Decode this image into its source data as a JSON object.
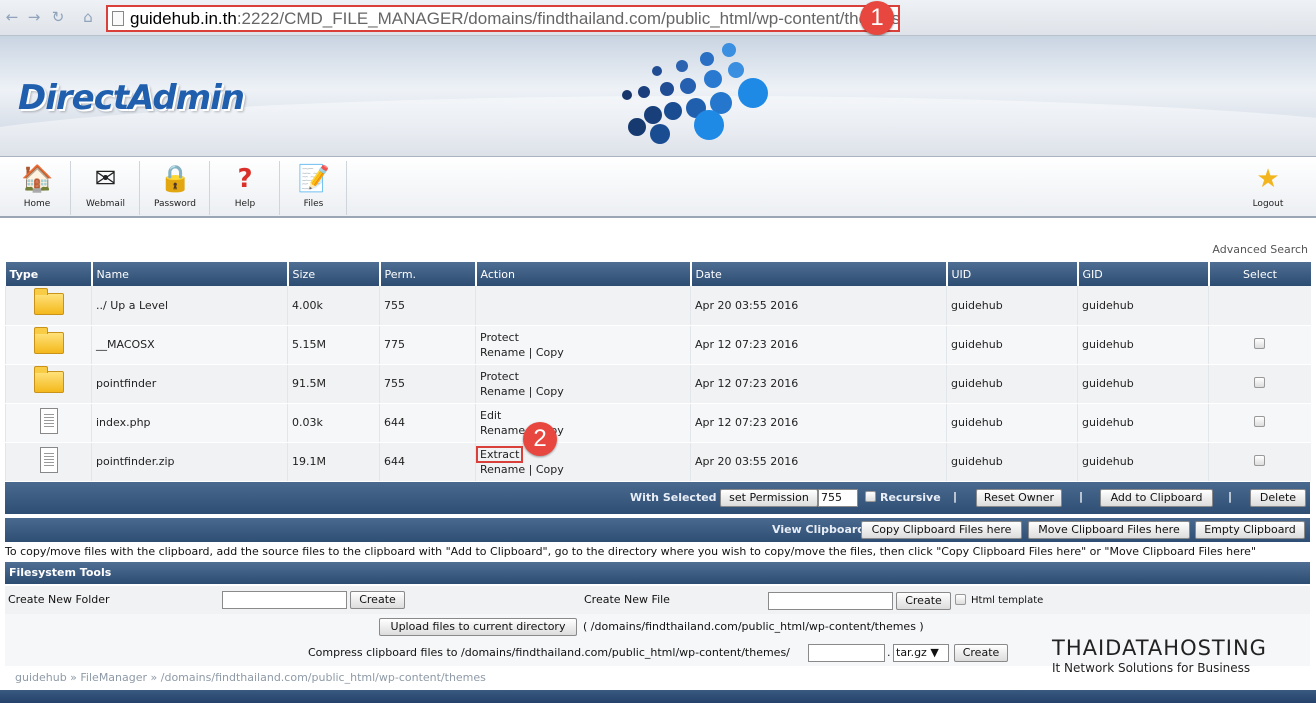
{
  "browser": {
    "url_host": "guidehub.in.th",
    "url_rest": ":2222/CMD_FILE_MANAGER/domains/findthailand.com/public_html/wp-content/themes",
    "callout_1": "1",
    "callout_2": "2"
  },
  "brand": {
    "logo": "DirectAdmin"
  },
  "toolbar": [
    {
      "label": "Home",
      "icon": "home-icon"
    },
    {
      "label": "Webmail",
      "icon": "webmail-icon"
    },
    {
      "label": "Password",
      "icon": "lock-icon"
    },
    {
      "label": "Help",
      "icon": "help-icon"
    },
    {
      "label": "Files",
      "icon": "files-icon"
    },
    {
      "label": "Logout",
      "icon": "star-icon"
    }
  ],
  "advanced_search": "Advanced Search",
  "table": {
    "headers": [
      "Type",
      "Name",
      "Size",
      "Perm.",
      "Action",
      "Date",
      "UID",
      "GID",
      "Select"
    ],
    "rows": [
      {
        "type": "folder",
        "name": "../ Up a Level",
        "size": "4.00k",
        "perm": "755",
        "action1": "",
        "action2a": "",
        "action2b": "",
        "date": "Apr 20 03:55 2016",
        "uid": "guidehub",
        "gid": "guidehub",
        "select": false
      },
      {
        "type": "folder",
        "name": "__MACOSX",
        "size": "5.15M",
        "perm": "775",
        "action1": "Protect",
        "action2a": "Rename",
        "action2b": "Copy",
        "date": "Apr 12 07:23 2016",
        "uid": "guidehub",
        "gid": "guidehub",
        "select": true
      },
      {
        "type": "folder",
        "name": "pointfinder",
        "size": "91.5M",
        "perm": "755",
        "action1": "Protect",
        "action2a": "Rename",
        "action2b": "Copy",
        "date": "Apr 12 07:23 2016",
        "uid": "guidehub",
        "gid": "guidehub",
        "select": true
      },
      {
        "type": "file",
        "name": "index.php",
        "size": "0.03k",
        "perm": "644",
        "action1": "Edit",
        "action2a": "Rename",
        "action2b": "Copy",
        "date": "Apr 12 07:23 2016",
        "uid": "guidehub",
        "gid": "guidehub",
        "select": true
      },
      {
        "type": "file",
        "name": "pointfinder.zip",
        "size": "19.1M",
        "perm": "644",
        "action1": "Extract",
        "action2a": "Rename",
        "action2b": "Copy",
        "date": "Apr 20 03:55 2016",
        "uid": "guidehub",
        "gid": "guidehub",
        "select": true
      }
    ],
    "action_sep": "|"
  },
  "selected_bar": {
    "label": "With Selected",
    "set_permission": "set Permission",
    "permission_value": "755",
    "recursive": "Recursive",
    "reset_owner": "Reset Owner",
    "add_to_clipboard": "Add to Clipboard",
    "delete": "Delete",
    "sep": "|"
  },
  "clipboard_bar": {
    "view_clipboard": "View Clipboard",
    "copy_here": "Copy Clipboard Files here",
    "move_here": "Move Clipboard Files here",
    "empty": "Empty Clipboard"
  },
  "clipboard_help": "To copy/move files with the clipboard, add the source files to the clipboard with \"Add to Clipboard\", go to the directory where you wish to copy/move the files, then click \"Copy Clipboard Files here\" or \"Move Clipboard Files here\"",
  "fs_tools": {
    "header": "Filesystem Tools",
    "create_folder_label": "Create New Folder",
    "create_button": "Create",
    "create_file_label": "Create New File",
    "html_template": "Html template",
    "upload_button": "Upload files to current directory",
    "upload_path": "( /domains/findthailand.com/public_html/wp-content/themes )",
    "compress_label": "Compress clipboard files to /domains/findthailand.com/public_html/wp-content/themes/",
    "compress_dot": ".",
    "compress_ext": "tar.gz ▼"
  },
  "breadcrumb": "guidehub » FileManager » /domains/findthailand.com/public_html/wp-content/themes",
  "watermark": {
    "title": "THAIDATAHOSTING",
    "subtitle": "It Network Solutions for Business"
  },
  "colors": {
    "header_blue": "#2d4c72",
    "callout_red": "#e8473f",
    "logo_blue": "#1f5fae"
  }
}
